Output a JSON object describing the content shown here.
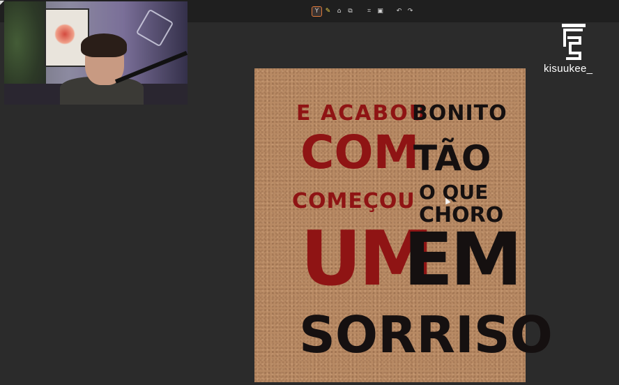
{
  "toolbar": {
    "tools": [
      {
        "icon": "filter-icon",
        "glyph": "Y"
      },
      {
        "icon": "highlighter-icon",
        "glyph": "✎"
      },
      {
        "icon": "eraser-icon",
        "glyph": "⌂"
      },
      {
        "icon": "shapes-icon",
        "glyph": "⧉"
      },
      {
        "icon": "crop-icon",
        "glyph": "⌗"
      },
      {
        "icon": "image-icon",
        "glyph": "▣"
      },
      {
        "icon": "undo-icon",
        "glyph": "↶"
      },
      {
        "icon": "redo-icon",
        "glyph": "↷"
      }
    ]
  },
  "stream": {
    "username": "kisuukee_",
    "logo_icon": "channel-logo-icon"
  },
  "poster": {
    "line1_red": "E ACABOU",
    "line1_black": "BONITO",
    "line2_red": "COM",
    "line2_black": "TÃO",
    "line3_red": "COMEÇOU",
    "line3_black": "O QUE",
    "line4_black": "CHORO",
    "line5_red": "UM",
    "line5_black": "EM",
    "line6_black": "SORRISO"
  },
  "colors": {
    "background": "#2b2b2b",
    "poster": "#b88a64",
    "red_ink": "#8f1414",
    "black_ink": "#151010",
    "accent": "#e07a3b"
  }
}
